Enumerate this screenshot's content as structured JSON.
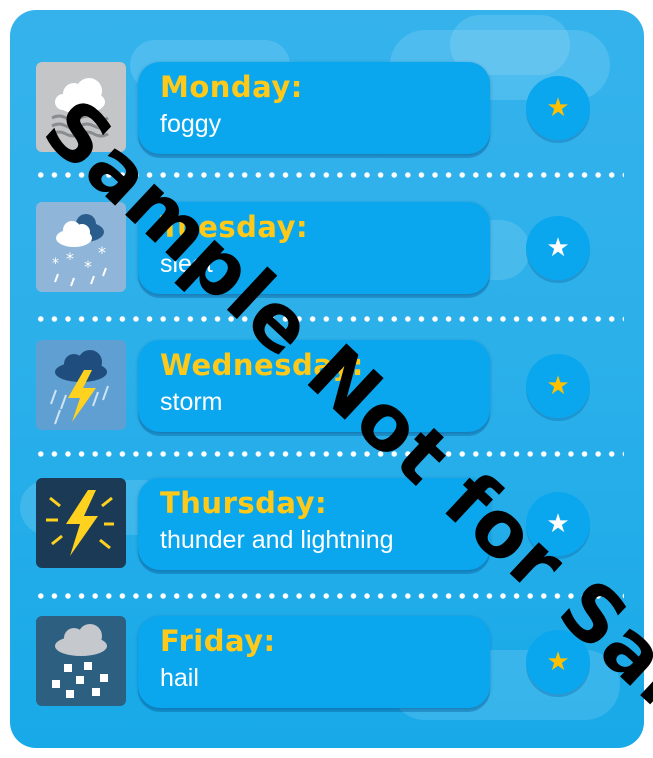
{
  "days": [
    {
      "day": "Monday:",
      "weather": "foggy",
      "icon": "fog-icon",
      "starred": true
    },
    {
      "day": "Tuesday:",
      "weather": "sleet",
      "icon": "sleet-icon",
      "starred": false
    },
    {
      "day": "Wednesday:",
      "weather": "storm",
      "icon": "storm-icon",
      "starred": true
    },
    {
      "day": "Thursday:",
      "weather": "thunder and lightning",
      "icon": "lightning-icon",
      "starred": false
    },
    {
      "day": "Friday:",
      "weather": "hail",
      "icon": "hail-icon",
      "starred": true
    }
  ],
  "watermark": "Sample Not for Sale",
  "colors": {
    "background": "#2cb0ea",
    "pill": "#0aa7ee",
    "day_text": "#ffc91a",
    "star_gold": "#ffc000",
    "star_white": "#ffffff"
  }
}
